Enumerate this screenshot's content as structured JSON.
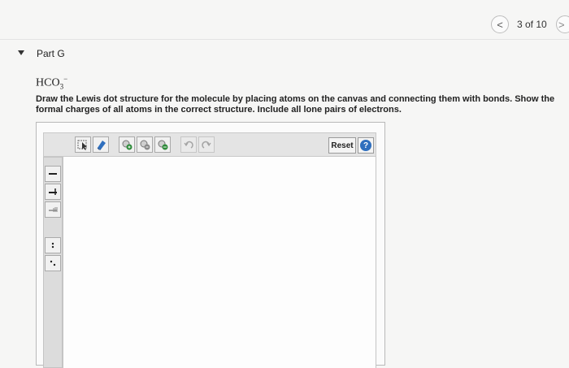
{
  "header": {
    "prev_icon": "chevron-left-icon",
    "prev_glyph": "<",
    "counter": "3 of 10",
    "next_icon": "chevron-right-icon",
    "next_glyph": ">"
  },
  "part": {
    "toggle_icon": "caret-down-icon",
    "title": "Part G"
  },
  "question": {
    "formula_base": "HCO",
    "formula_sub": "3",
    "formula_sup": "−",
    "instructions": "Draw the Lewis dot structure for the molecule by placing atoms on the canvas and connecting them with bonds. Show the formal charges of all atoms in the correct structure. Include all lone pairs of electrons."
  },
  "editor": {
    "reset_label": "Reset",
    "help_glyph": "?",
    "toolbar_icons": [
      "select-icon",
      "eraser-icon",
      "add-charge-icon",
      "remove-charge-icon",
      "add-lone-pair-icon",
      "undo-icon",
      "redo-icon",
      "help-icon"
    ],
    "side_icons": [
      "single-bond-icon",
      "double-bond-icon",
      "triple-bond-icon",
      "lone-pair-icon",
      "radical-icon"
    ],
    "colors": {
      "help_blue": "#2f6fbe",
      "eraser_blue": "#2f6fbe",
      "charge_green": "#2e8b3a"
    }
  }
}
